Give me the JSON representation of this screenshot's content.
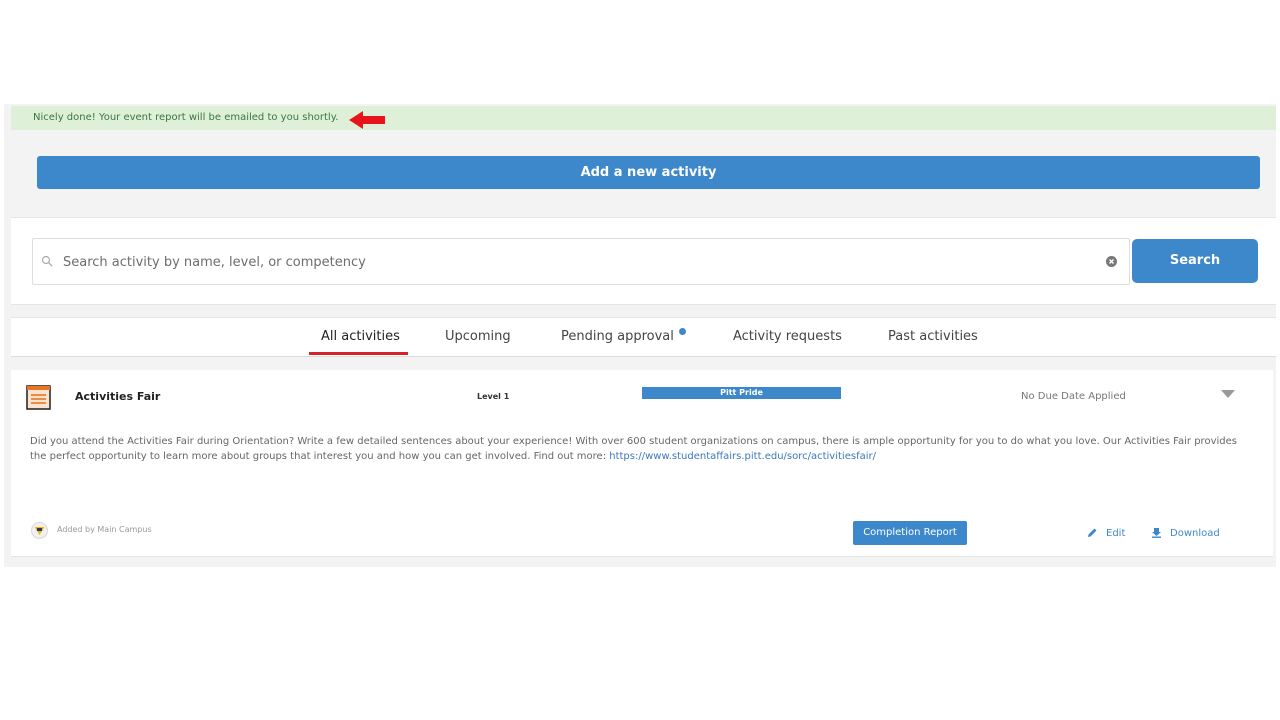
{
  "banner": {
    "message": "Nicely done! Your event report will be emailed to you shortly.",
    "arrow_icon": "red-left-arrow-icon"
  },
  "add_button": {
    "label": "Add a new activity"
  },
  "search": {
    "placeholder": "Search activity by name, level, or competency",
    "value": "",
    "button_label": "Search"
  },
  "tabs": [
    {
      "label": "All activities",
      "active": true
    },
    {
      "label": "Upcoming",
      "active": false
    },
    {
      "label": "Pending approval",
      "active": false,
      "has_dot": true
    },
    {
      "label": "Activity requests",
      "active": false
    },
    {
      "label": "Past activities",
      "active": false
    }
  ],
  "activity": {
    "title": "Activities Fair",
    "level": "Level 1",
    "tag": "Pitt Pride",
    "due": "No Due Date Applied",
    "description": "Did you attend the Activities Fair during Orientation? Write a few detailed sentences about your experience! With over 600 student organizations on campus, there is ample opportunity for you to do what you love. Our Activities Fair provides the perfect opportunity to learn more about groups that interest you and how you can get involved. Find out more: ",
    "link": "https://www.studentaffairs.pitt.edu/sorc/activitiesfair/",
    "added_by": "Added by Main Campus",
    "completion_report_label": "Completion Report",
    "edit_label": "Edit",
    "download_label": "Download"
  },
  "colors": {
    "accent": "#3d88cb",
    "banner_bg": "#dff0d8",
    "banner_text": "#3c763d",
    "tab_underline": "#d9232b"
  }
}
